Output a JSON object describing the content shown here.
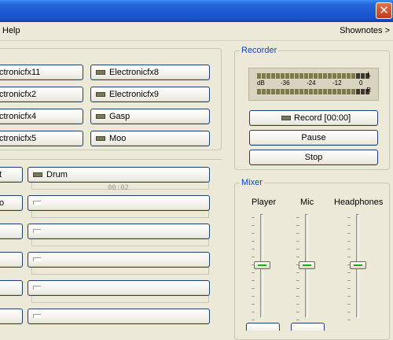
{
  "window": {
    "close_glyph": "✕"
  },
  "menu": {
    "help": "Help",
    "shownotes": "Shownotes >"
  },
  "sounds": [
    {
      "label": "ctronicfx11"
    },
    {
      "label": "Electronicfx8"
    },
    {
      "label": "ctronicfx2"
    },
    {
      "label": "Electronicfx9"
    },
    {
      "label": "ctronicfx4"
    },
    {
      "label": "Gasp"
    },
    {
      "label": "ctronicfx5"
    },
    {
      "label": "Moo"
    }
  ],
  "players": {
    "drum_label": "Drum",
    "drum_time": "00:02",
    "cut_left": [
      "t",
      "o"
    ]
  },
  "recorder": {
    "title": "Recorder",
    "vu": {
      "db": "dB",
      "m36": "-36",
      "m24": "-24",
      "m12": "-12",
      "zero": "0",
      "L": "L",
      "R": "R"
    },
    "record_label": "Record [00:00]",
    "pause_label": "Pause",
    "stop_label": "Stop"
  },
  "mixer": {
    "title": "Mixer",
    "channels": [
      {
        "label": "Player"
      },
      {
        "label": "Mic"
      },
      {
        "label": "Headphones"
      }
    ]
  },
  "colors": {
    "titlebar": "#1b57cf",
    "group_title": "#0a46d6",
    "button_border": "#1f3f73",
    "face": "#ece9d8"
  }
}
